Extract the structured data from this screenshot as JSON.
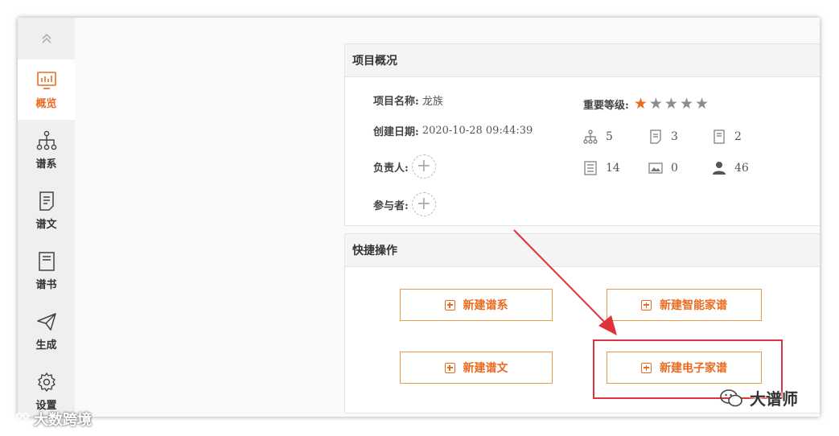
{
  "sidebar": {
    "items": [
      {
        "label": "概览",
        "icon": "chart-monitor-icon"
      },
      {
        "label": "谱系",
        "icon": "tree-icon"
      },
      {
        "label": "谱文",
        "icon": "document-icon"
      },
      {
        "label": "谱书",
        "icon": "book-icon"
      },
      {
        "label": "生成",
        "icon": "paper-plane-icon"
      },
      {
        "label": "设置",
        "icon": "gear-icon"
      }
    ],
    "active": "概览"
  },
  "overview": {
    "title": "项目概况",
    "project_name_label": "项目名称:",
    "project_name": "龙族",
    "created_label": "创建日期:",
    "created": "2020-10-28 09:44:39",
    "owner_label": "负责人:",
    "participants_label": "参与者:",
    "importance_label": "重要等级:",
    "importance_stars": 1,
    "importance_max": 5,
    "stats": [
      {
        "icon": "tree-icon",
        "value": "5"
      },
      {
        "icon": "document-icon",
        "value": "3"
      },
      {
        "icon": "book-icon",
        "value": "2"
      },
      {
        "icon": "list-icon",
        "value": "14"
      },
      {
        "icon": "image-icon",
        "value": "0"
      },
      {
        "icon": "person-icon",
        "value": "46"
      }
    ]
  },
  "quick": {
    "title": "快捷操作",
    "new_lineage": "新建谱系",
    "new_smart_genealogy": "新建智能家谱",
    "new_text": "新建谱文",
    "new_e_genealogy": "新建电子家谱"
  },
  "watermarks": {
    "left": "大数跨境",
    "right": "大谱师"
  },
  "colors": {
    "accent": "#ea6b1f",
    "highlight": "#e0323a"
  }
}
